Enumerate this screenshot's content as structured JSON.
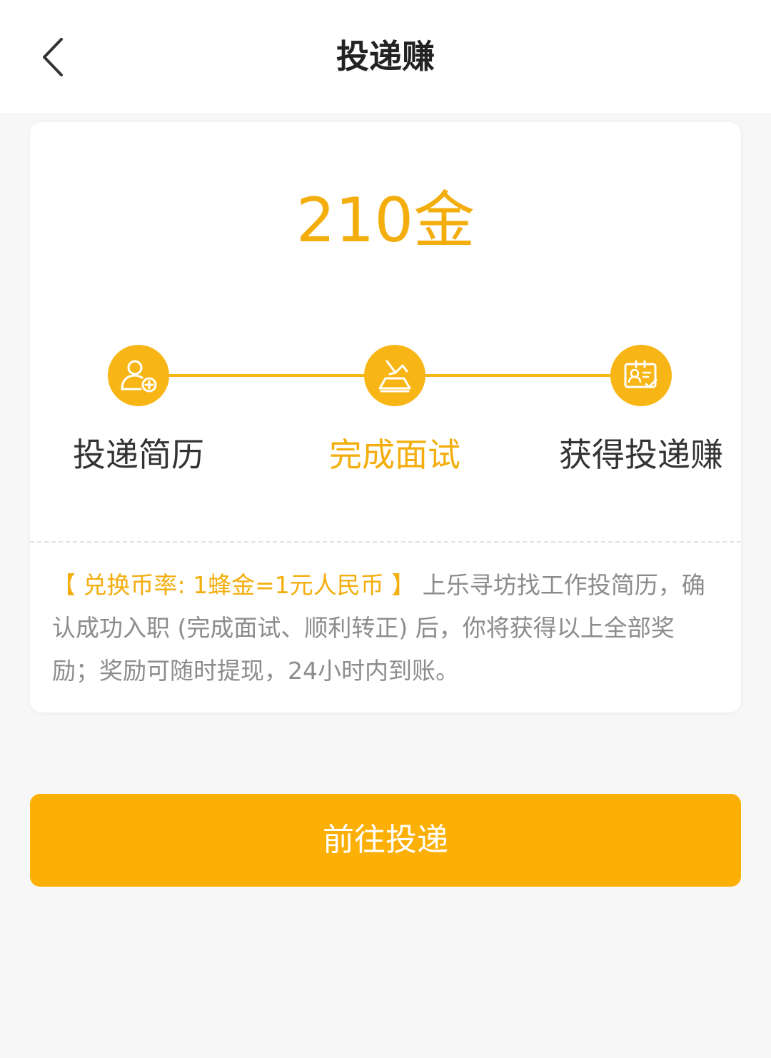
{
  "header": {
    "title": "投递赚",
    "back_icon": "chevron-left-icon"
  },
  "reward": {
    "amount": "210金"
  },
  "steps": [
    {
      "label": "投递简历",
      "icon": "user-add-icon",
      "active": false
    },
    {
      "label": "完成面试",
      "icon": "interview-icon",
      "active": true
    },
    {
      "label": "获得投递赚",
      "icon": "id-card-check-icon",
      "active": false
    }
  ],
  "info": {
    "rate": "【 兑换币率: 1蜂金=1元人民币 】",
    "description": " 上乐寻坊找工作投简历，确认成功入职 (完成面试、顺利转正) 后，你将获得以上全部奖励；奖励可随时提现，24小时内到账。"
  },
  "cta": {
    "label": "前往投递"
  },
  "colors": {
    "accent": "#f8b516",
    "accent_text": "#f3ae0e",
    "button": "#fcaf05",
    "background": "#f7f7f7"
  }
}
